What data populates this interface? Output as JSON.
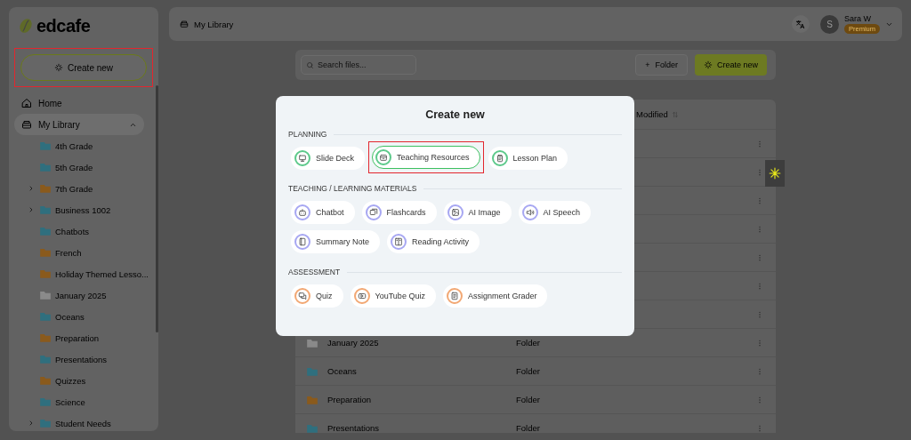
{
  "sidebar": {
    "logo": "edcafe",
    "create_button": {
      "label": "Create new",
      "highlighted": true
    },
    "items": [
      {
        "label": "Home",
        "kind": "home",
        "selected": false
      },
      {
        "label": "My Library",
        "kind": "library",
        "selected": true,
        "expanded": true,
        "children": [
          {
            "label": "4th Grade",
            "color": "#2f6f7e",
            "expandable": false
          },
          {
            "label": "5th Grade",
            "color": "#2f6f7e",
            "expandable": false
          },
          {
            "label": "7th Grade",
            "color": "#8a5a1c",
            "expandable": true
          },
          {
            "label": "Business 1002",
            "color": "#2f6f7e",
            "expandable": true
          },
          {
            "label": "Chatbots",
            "color": "#2f6f7e",
            "expandable": false
          },
          {
            "label": "French",
            "color": "#8a5a1c",
            "expandable": false
          },
          {
            "label": "Holiday Themed Lesso...",
            "color": "#8a5a1c",
            "expandable": false
          },
          {
            "label": "January 2025",
            "color": "#8a8a8a",
            "expandable": false
          },
          {
            "label": "Oceans",
            "color": "#2f6f7e",
            "expandable": false
          },
          {
            "label": "Preparation",
            "color": "#8a5a1c",
            "expandable": false
          },
          {
            "label": "Presentations",
            "color": "#2f6f7e",
            "expandable": false
          },
          {
            "label": "Quizzes",
            "color": "#8a5a1c",
            "expandable": false
          },
          {
            "label": "Science",
            "color": "#2f6f7e",
            "expandable": false
          },
          {
            "label": "Student Needs",
            "color": "#2f6f7e",
            "expandable": true
          }
        ]
      }
    ]
  },
  "topbar": {
    "breadcrumb": "My Library",
    "user": {
      "initial": "S",
      "name": "Sara W",
      "plan": "Premium"
    }
  },
  "toolbar": {
    "search": {
      "placeholder": "Search files..."
    },
    "folder_button": "Folder",
    "folder_icon": "+",
    "create_button": "Create new"
  },
  "table": {
    "columns": [
      {
        "label": "Modified",
        "sortable": true
      }
    ],
    "rows": [
      {
        "kind": "covered"
      },
      {
        "kind": "covered"
      },
      {
        "kind": "covered"
      },
      {
        "kind": "covered"
      },
      {
        "kind": "covered"
      },
      {
        "kind": "covered"
      },
      {
        "kind": "covered"
      },
      {
        "kind": "folder",
        "name": "January 2025",
        "type": "Folder",
        "color": "#8a8a8a"
      },
      {
        "kind": "folder",
        "name": "Oceans",
        "type": "Folder",
        "color": "#2f6f7e"
      },
      {
        "kind": "folder",
        "name": "Preparation",
        "type": "Folder",
        "color": "#8a5a1c"
      },
      {
        "kind": "folder",
        "name": "Presentations",
        "type": "Folder",
        "color": "#2f6f7e"
      }
    ]
  },
  "modal": {
    "title": "Create new",
    "sections": [
      {
        "heading": "PLANNING",
        "color": "#5cc98a",
        "items": [
          {
            "label": "Slide Deck",
            "selected": false
          },
          {
            "label": "Teaching Resources",
            "selected": true
          },
          {
            "label": "Lesson Plan",
            "selected": false
          }
        ]
      },
      {
        "heading": "TEACHING / LEARNING MATERIALS",
        "color": "#a7a7f2",
        "items": [
          {
            "label": "Chatbot",
            "selected": false
          },
          {
            "label": "Flashcards",
            "selected": false
          },
          {
            "label": "AI Image",
            "selected": false
          },
          {
            "label": "AI Speech",
            "selected": false
          },
          {
            "label": "Summary Note",
            "selected": false
          },
          {
            "label": "Reading Activity",
            "selected": false
          }
        ]
      },
      {
        "heading": "ASSESSMENT",
        "color": "#f2a874",
        "items": [
          {
            "label": "Quiz",
            "selected": false
          },
          {
            "label": "YouTube Quiz",
            "selected": false
          },
          {
            "label": "Assignment Grader",
            "selected": false
          }
        ]
      }
    ]
  }
}
